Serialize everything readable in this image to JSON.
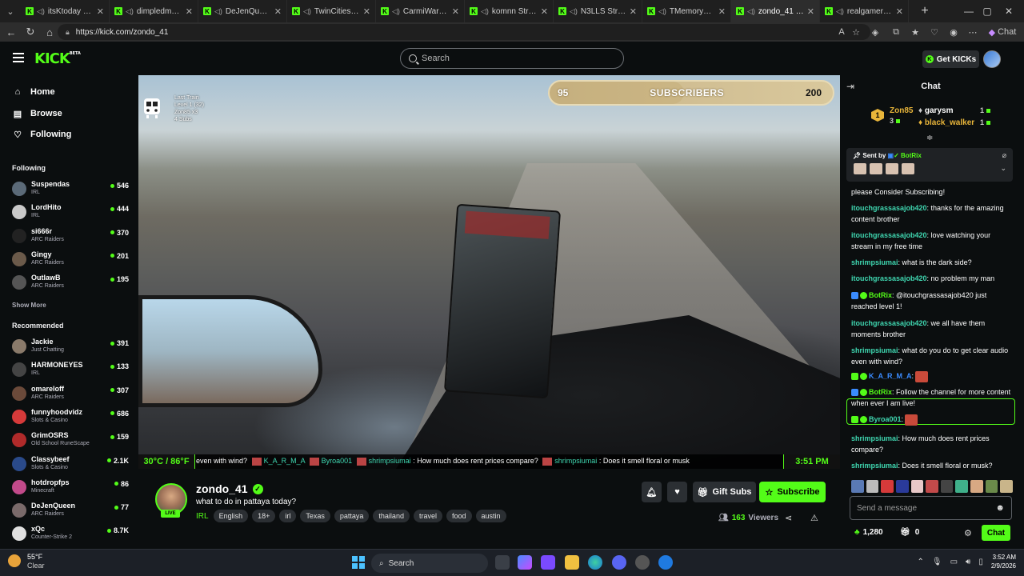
{
  "browser": {
    "tabs": [
      {
        "title": "itsKtoday Stream",
        "active": false
      },
      {
        "title": "dimpledmping Stream",
        "active": false
      },
      {
        "title": "DeJenQueen Stream",
        "active": false
      },
      {
        "title": "TwinCitiesKing Stream",
        "active": false
      },
      {
        "title": "CarmiWarmy Stream",
        "active": false
      },
      {
        "title": "komnn Stream",
        "active": false
      },
      {
        "title": "N3LLS Stream -",
        "active": false
      },
      {
        "title": "TMemoryy Stream",
        "active": false
      },
      {
        "title": "zondo_41 Stream",
        "active": true
      },
      {
        "title": "realgamer1985",
        "active": false
      }
    ],
    "url": "https://kick.com/zondo_41",
    "copilot_label": "Chat"
  },
  "header": {
    "logo": "KICK",
    "logo_badge": "BETA",
    "search_placeholder": "Search",
    "get_kicks_label": "Get KICKs"
  },
  "sidebar": {
    "nav": [
      {
        "label": "Home",
        "icon": "home-icon"
      },
      {
        "label": "Browse",
        "icon": "browse-icon"
      },
      {
        "label": "Following",
        "icon": "heart-icon"
      }
    ],
    "following_heading": "Following",
    "following": [
      {
        "name": "Suspendas",
        "category": "IRL",
        "viewers": "546",
        "color": "#5b6a78"
      },
      {
        "name": "LordHito",
        "category": "IRL",
        "viewers": "444",
        "color": "#c9c9c9"
      },
      {
        "name": "si666r",
        "category": "ARC Raiders",
        "viewers": "370",
        "color": "#222"
      },
      {
        "name": "Gingy",
        "category": "ARC Raiders",
        "viewers": "201",
        "color": "#6b5a4a"
      },
      {
        "name": "OutlawB",
        "category": "ARC Raiders",
        "viewers": "195",
        "color": "#555"
      }
    ],
    "show_more": "Show More",
    "recommended_heading": "Recommended",
    "recommended": [
      {
        "name": "Jackie",
        "category": "Just Chatting",
        "viewers": "391",
        "color": "#8a7a6a"
      },
      {
        "name": "HARMONEYES",
        "category": "IRL",
        "viewers": "133",
        "color": "#444"
      },
      {
        "name": "omareloff",
        "category": "ARC Raiders",
        "viewers": "307",
        "color": "#6b4a3a"
      },
      {
        "name": "funnyhoodvidz",
        "category": "Slots & Casino",
        "viewers": "686",
        "color": "#d63a3a"
      },
      {
        "name": "GrimOSRS",
        "category": "Old School RuneScape",
        "viewers": "159",
        "color": "#b02a2a"
      },
      {
        "name": "Classybeef",
        "category": "Slots & Casino",
        "viewers": "2.1K",
        "color": "#2a4a8a"
      },
      {
        "name": "hotdropfps",
        "category": "Minecraft",
        "viewers": "86",
        "color": "#c24a8a"
      },
      {
        "name": "DeJenQueen",
        "category": "ARC Raiders",
        "viewers": "77",
        "color": "#7a6a6a"
      },
      {
        "name": "xQc",
        "category": "Counter-Strike 2",
        "viewers": "8.7K",
        "color": "#e0e0e0"
      }
    ]
  },
  "video_overlay": {
    "train": {
      "line1": "Last Train",
      "line2": "Level 1  (32)",
      "line3": "Zon85 x3",
      "line4": "4 Subs"
    },
    "sub_goal": {
      "current": "95",
      "label": "SUBSCRIBERS",
      "target": "200"
    },
    "sub_goal_progress": 0.475,
    "temperature": "30°C / 86°F",
    "clock": "3:51 PM",
    "ticker": [
      {
        "text": "even with wind?",
        "user": false
      },
      {
        "text": "K_A_R_M_A",
        "user": true
      },
      {
        "text": "Byroa001",
        "user": true
      },
      {
        "text": "shrimpsiumai",
        "user": true
      },
      {
        "text": ": How much does rent prices compare?",
        "user": false
      },
      {
        "text": "shrimpsiumai",
        "user": true
      },
      {
        "text": ": Does it smell floral or musk",
        "user": false
      }
    ]
  },
  "stream": {
    "username": "zondo_41",
    "live_label": "LIVE",
    "title": "what to do in pattaya today?",
    "category": "IRL",
    "tags": [
      "English",
      "18+",
      "irl",
      "Texas",
      "pattaya",
      "thailand",
      "travel",
      "food",
      "austin"
    ],
    "gift_subs_label": "Gift Subs",
    "subscribe_label": "Subscribe",
    "viewer_count": "163",
    "viewers_label": "Viewers"
  },
  "chat": {
    "title": "Chat",
    "leaderboard": {
      "rank": "1",
      "top": {
        "name": "Zon85",
        "count": "3"
      },
      "gift1": {
        "name": "garysm",
        "count": "1"
      },
      "gift2": {
        "name": "black_walker",
        "count": "1"
      }
    },
    "pinned": {
      "sent_by": "Sent by",
      "bot": "BotRix"
    },
    "messages": [
      {
        "user": "",
        "text": "please Consider Subscribing!",
        "kind": "plain"
      },
      {
        "user": "itouchgrassasajob420",
        "text": ": thanks for the amazing content brother",
        "kind": "user"
      },
      {
        "user": "itouchgrassasajob420",
        "text": ": love watching your stream in my free time",
        "kind": "user"
      },
      {
        "user": "shrimpsiumai",
        "text": ": what is the dark side?",
        "kind": "user"
      },
      {
        "user": "itouchgrassasajob420",
        "text": ": no problem my man",
        "kind": "user"
      },
      {
        "user": "BotRix",
        "text": ": @itouchgrassasajob420 just reached level 1!",
        "kind": "bot"
      },
      {
        "user": "itouchgrassasajob420",
        "text": ": we all have them moments brother",
        "kind": "user"
      },
      {
        "user": "shrimpsiumai",
        "text": ": what do you do to get clear audio even with wind?",
        "kind": "user"
      },
      {
        "user": "K_A_R_M_A",
        "text": ":",
        "kind": "karma"
      },
      {
        "user": "BotRix",
        "text": ": Follow the channel for more content when ever I am live!",
        "kind": "bot"
      },
      {
        "user": "Byroa001",
        "text": ":",
        "kind": "badge"
      },
      {
        "user": "shrimpsiumai",
        "text": ": How much does rent prices compare?",
        "kind": "user"
      },
      {
        "user": "shrimpsiumai",
        "text": ": Does it smell floral or musk?",
        "kind": "user"
      }
    ],
    "input_placeholder": "Send a message",
    "points": "1,280",
    "gifts": "0",
    "send_label": "Chat"
  },
  "taskbar": {
    "weather_temp": "55°F",
    "weather_cond": "Clear",
    "search_label": "Search",
    "time": "3:52 AM",
    "date": "2/9/2026"
  }
}
